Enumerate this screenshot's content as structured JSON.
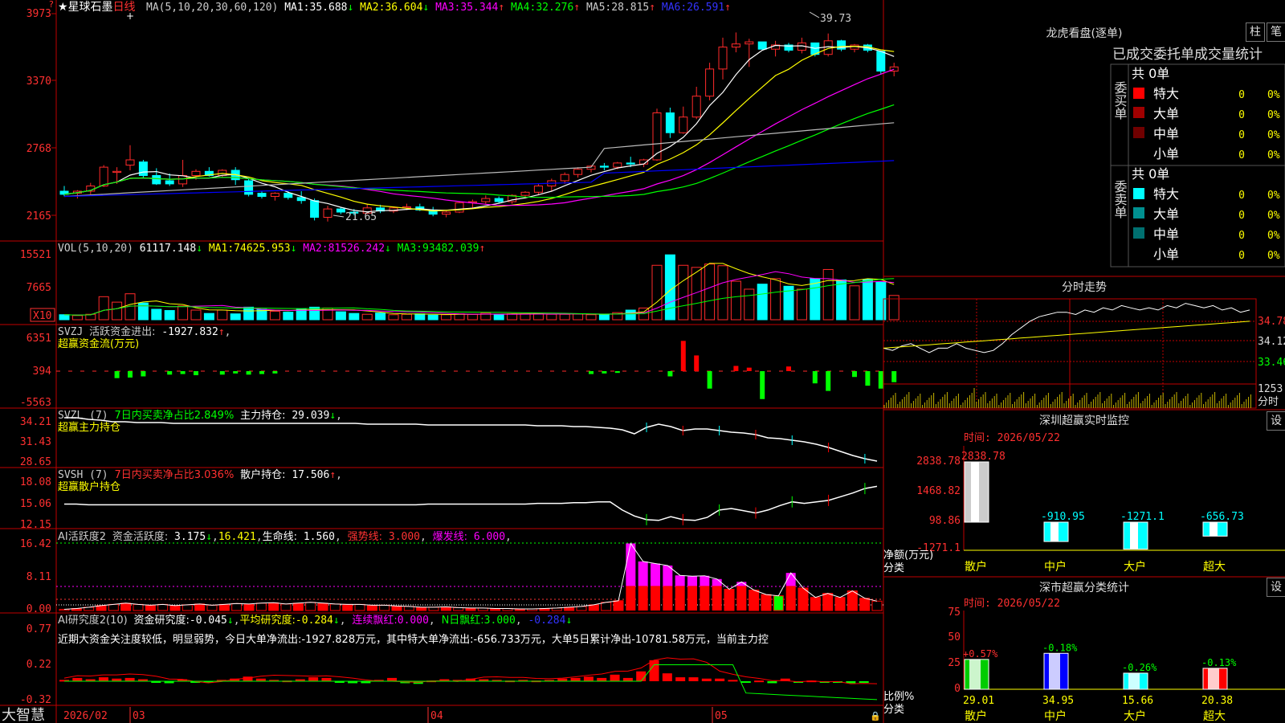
{
  "colors": {
    "up": "#ff2a2a",
    "down": "#00ffff",
    "ma1": "#ffffff",
    "ma2": "#ffff00",
    "ma3": "#ff00ff",
    "ma4": "#00ff00",
    "ma5": "#bbbbbb",
    "ma6": "#0000ff",
    "grid": "#c00000",
    "label": "#ff3030"
  },
  "main_panel": {
    "star": "★",
    "name": "星球石墨",
    "period": "日线",
    "ma_params": "MA(5,10,20,30,60,120)",
    "ma": [
      {
        "name": "MA1:",
        "value": "35.688",
        "arrow": "↓"
      },
      {
        "name": "MA2:",
        "value": "36.604",
        "arrow": "↓"
      },
      {
        "name": "MA3:",
        "value": "35.344",
        "arrow": "↑"
      },
      {
        "name": "MA4:",
        "value": "32.276",
        "arrow": "↑"
      },
      {
        "name": "MA5:",
        "value": "28.815",
        "arrow": "↑"
      },
      {
        "name": "MA6:",
        "value": "26.591",
        "arrow": "↑"
      }
    ],
    "yticks": [
      "3973",
      "3370",
      "2768",
      "2165"
    ],
    "high_label": "39.73",
    "low_label": "21.65"
  },
  "vol_panel": {
    "title": "VOL(5,10,20)",
    "value": "61117.148",
    "arrow": "↓",
    "ma": [
      {
        "name": "MA1:",
        "value": "74625.953",
        "arrow": "↓"
      },
      {
        "name": "MA2:",
        "value": "81526.242",
        "arrow": "↓"
      },
      {
        "name": "MA3:",
        "value": "93482.039",
        "arrow": "↑"
      }
    ],
    "yticks": [
      "15521",
      "7665"
    ],
    "unit": "X10"
  },
  "svzj_panel": {
    "code": "SVZJ",
    "label": "活跃资金进出:",
    "value": "-1927.832",
    "arrow": "↑",
    "tail": ",",
    "sub": "超赢资金流(万元)",
    "yticks": [
      "6351",
      "394",
      "-5563"
    ]
  },
  "svzl_panel": {
    "code": "SVZL (7)",
    "label": "7日内买卖净占比2.849%",
    "label2": "主力持仓:",
    "value": "29.039",
    "arrow": "↓",
    "tail": ",",
    "sub": "超赢主力持仓",
    "yticks": [
      "34.21",
      "31.43",
      "28.65"
    ]
  },
  "svsh_panel": {
    "code": "SVSH (7)",
    "label": "7日内买卖净占比3.036%",
    "label2": "散户持仓:",
    "value": "17.506",
    "arrow": "↑",
    "tail": ",",
    "sub": "超赢散户持仓",
    "yticks": [
      "18.08",
      "15.06",
      "12.15"
    ]
  },
  "ai1_panel": {
    "code": "AI活跃度2",
    "label": "资金活跃度:",
    "v1": "3.175",
    "a1": "↓",
    "v2": "16.421",
    "l3": "生命线:",
    "v3": "1.560",
    "l4": "强势线:",
    "v4": "3.000",
    "l5": "爆发线:",
    "v5": "6.000",
    "tail": ",",
    "yticks": [
      "16.42",
      "8.11",
      "0.00"
    ]
  },
  "ai2_panel": {
    "code": "AI研究度2(10)",
    "l1": "资金研究度:",
    "v1": "-0.045",
    "a1": "↓",
    "l2": "平均研究度:",
    "v2": "-0.284",
    "a2": "↓",
    "l3": "连续飘红:",
    "v3": "0.000",
    "l4": "N日飘红:",
    "v4": "3.000",
    "v5": "-0.284",
    "a5": "↓",
    "comment": "近期大资金关注度较低，明显弱势，今日大单净流出:-1927.828万元，其中特大单净流出:-656.733万元，大单5日累计净出-10781.58万元，当前主力控",
    "yticks": [
      "0.77",
      "0.22",
      "-0.32"
    ]
  },
  "bottom_bar": {
    "app": "大智慧",
    "start": "2026/02",
    "months": [
      "03",
      "04",
      "05"
    ]
  },
  "longhu": {
    "title": "龙虎看盘(逐单)",
    "btn1": "柱",
    "btn2": "笔",
    "tabs": "已成交委托单成交量统计",
    "buy": {
      "header": "共 0单",
      "side_label": "委买单",
      "rows": [
        {
          "name": "特大",
          "n": "0",
          "p": "0%"
        },
        {
          "name": "大单",
          "n": "0",
          "p": "0%"
        },
        {
          "name": "中单",
          "n": "0",
          "p": "0%"
        },
        {
          "name": "小单",
          "n": "0",
          "p": "0%"
        }
      ]
    },
    "sell": {
      "header": "共 0单",
      "side_label": "委卖单",
      "rows": [
        {
          "name": "特大",
          "n": "0",
          "p": "0%"
        },
        {
          "name": "大单",
          "n": "0",
          "p": "0%"
        },
        {
          "name": "中单",
          "n": "0",
          "p": "0%"
        },
        {
          "name": "小单",
          "n": "0",
          "p": "0%"
        }
      ]
    }
  },
  "intraday": {
    "title": "分时走势",
    "right": [
      "34.78",
      "34.12",
      "33.46",
      "1253"
    ],
    "foot": "分时"
  },
  "monitor": {
    "title": "深圳超赢实时监控",
    "btn": "设",
    "time": "时间: 2026/05/22",
    "yticks": [
      "2838.78",
      "1468.82",
      "98.86",
      "-1271.1"
    ],
    "bar_labels": [
      "2838.78",
      "-910.95",
      "-1271.1",
      "-656.73"
    ],
    "cats": [
      "散户",
      "中户",
      "大户",
      "超大"
    ],
    "ylabel": "净额(万元)",
    "xlabel": "分类"
  },
  "classify": {
    "title": "深市超赢分类统计",
    "btn": "设",
    "time": "时间: 2026/05/22",
    "yticks": [
      "75",
      "50",
      "25",
      "0"
    ],
    "top_labels": [
      "+0.57%",
      "-0.18%",
      "-0.26%",
      "-0.13%"
    ],
    "bottom_labels": [
      "29.01",
      "34.95",
      "15.66",
      "20.38"
    ],
    "cats": [
      "散户",
      "中户",
      "大户",
      "超大"
    ],
    "ylabel": "比例%",
    "xlabel": "分类"
  },
  "chart_data": [
    {
      "type": "candlestick",
      "name": "星球石墨 日线",
      "ylim": [
        20.5,
        41.5
      ],
      "ohlc": [
        [
          24.5,
          25.0,
          24.0,
          24.2
        ],
        [
          24.3,
          24.6,
          23.8,
          24.5
        ],
        [
          24.5,
          25.3,
          24.2,
          25.0
        ],
        [
          25.0,
          27.0,
          24.9,
          26.8
        ],
        [
          26.3,
          26.8,
          25.2,
          26.4
        ],
        [
          27.0,
          28.9,
          26.5,
          27.5
        ],
        [
          27.3,
          27.5,
          25.8,
          26.0
        ],
        [
          26.0,
          26.7,
          25.1,
          25.2
        ],
        [
          25.5,
          26.2,
          25.0,
          25.2
        ],
        [
          25.2,
          27.5,
          24.9,
          26.0
        ],
        [
          26.0,
          26.6,
          25.6,
          26.4
        ],
        [
          26.4,
          26.8,
          25.9,
          26.0
        ],
        [
          26.0,
          26.6,
          25.8,
          26.5
        ],
        [
          26.5,
          26.8,
          25.1,
          25.6
        ],
        [
          25.5,
          25.7,
          24.0,
          24.2
        ],
        [
          24.3,
          24.5,
          23.8,
          24.0
        ],
        [
          24.0,
          24.4,
          23.6,
          24.3
        ],
        [
          24.3,
          24.5,
          23.7,
          23.9
        ],
        [
          23.9,
          24.5,
          23.3,
          23.6
        ],
        [
          23.6,
          23.8,
          21.7,
          22.0
        ],
        [
          22.0,
          23.1,
          21.6,
          22.8
        ],
        [
          22.8,
          23.0,
          22.3,
          22.5
        ],
        [
          22.5,
          22.8,
          22.2,
          22.4
        ],
        [
          22.4,
          23.3,
          22.3,
          22.9
        ],
        [
          22.9,
          23.2,
          22.4,
          22.6
        ],
        [
          22.6,
          23.0,
          22.4,
          22.9
        ],
        [
          22.9,
          23.3,
          22.7,
          23.0
        ],
        [
          23.0,
          23.3,
          22.6,
          22.7
        ],
        [
          22.7,
          23.0,
          22.1,
          22.3
        ],
        [
          22.3,
          22.6,
          22.0,
          22.5
        ],
        [
          22.5,
          23.5,
          22.4,
          23.4
        ],
        [
          23.4,
          23.7,
          22.9,
          23.5
        ],
        [
          23.5,
          24.1,
          23.3,
          23.8
        ],
        [
          23.8,
          24.0,
          23.3,
          23.5
        ],
        [
          23.5,
          24.2,
          23.3,
          24.1
        ],
        [
          24.1,
          24.5,
          23.8,
          24.4
        ],
        [
          24.4,
          25.2,
          24.1,
          25.0
        ],
        [
          25.0,
          25.7,
          24.5,
          25.5
        ],
        [
          25.5,
          26.3,
          25.2,
          26.1
        ],
        [
          26.1,
          26.8,
          25.8,
          26.6
        ],
        [
          26.6,
          27.0,
          26.3,
          26.9
        ],
        [
          26.9,
          27.2,
          26.5,
          26.8
        ],
        [
          26.8,
          27.3,
          26.6,
          27.2
        ],
        [
          27.2,
          27.8,
          26.8,
          27.1
        ],
        [
          27.1,
          27.6,
          26.8,
          27.5
        ],
        [
          27.5,
          32.4,
          27.4,
          32.0
        ],
        [
          32.0,
          32.5,
          29.6,
          30.1
        ],
        [
          30.1,
          32.6,
          30.0,
          31.6
        ],
        [
          31.6,
          34.5,
          31.4,
          33.6
        ],
        [
          33.6,
          36.8,
          33.2,
          36.2
        ],
        [
          36.2,
          39.2,
          35.2,
          38.3
        ],
        [
          38.3,
          39.7,
          37.8,
          38.6
        ],
        [
          38.6,
          39.1,
          36.4,
          38.8
        ],
        [
          38.8,
          38.8,
          38.0,
          38.1
        ],
        [
          38.1,
          38.9,
          37.4,
          38.5
        ],
        [
          38.5,
          38.7,
          37.8,
          38.0
        ],
        [
          38.0,
          39.2,
          37.7,
          38.7
        ],
        [
          38.7,
          38.7,
          37.4,
          37.6
        ],
        [
          37.6,
          39.6,
          37.4,
          38.9
        ],
        [
          38.9,
          39.0,
          37.9,
          38.1
        ],
        [
          38.1,
          38.6,
          37.8,
          38.5
        ],
        [
          38.5,
          38.6,
          37.8,
          38.0
        ],
        [
          37.9,
          37.9,
          35.7,
          36.0
        ],
        [
          36.0,
          36.8,
          35.5,
          36.4
        ]
      ]
    },
    {
      "type": "bar",
      "name": "VOL",
      "ylim": [
        0,
        16500
      ],
      "values": [
        1200,
        1000,
        1300,
        5500,
        4200,
        6200,
        4000,
        2500,
        2200,
        3300,
        2300,
        1500,
        2300,
        1400,
        3000,
        2500,
        2000,
        1800,
        2500,
        3000,
        2800,
        1900,
        1500,
        1300,
        1600,
        1200,
        1300,
        1400,
        1100,
        1200,
        1400,
        1300,
        1600,
        1200,
        1400,
        1400,
        1500,
        1300,
        1300,
        1400,
        1200,
        1300,
        1700,
        2300,
        2800,
        13000,
        15500,
        13000,
        12500,
        13300,
        12900,
        9200,
        7300,
        8500,
        9800,
        8000,
        7300,
        9800,
        12000,
        9500,
        8100,
        9600,
        9000,
        5800
      ]
    },
    {
      "type": "bar",
      "name": "超赢资金流(万元)",
      "ylim": [
        -6000,
        6600
      ],
      "values": [
        0,
        0,
        0,
        0,
        -1200,
        -1100,
        -900,
        0,
        -600,
        -500,
        -700,
        0,
        -600,
        -400,
        -600,
        -500,
        -400,
        0,
        0,
        0,
        0,
        0,
        0,
        0,
        0,
        0,
        0,
        0,
        0,
        0,
        0,
        0,
        0,
        0,
        0,
        0,
        0,
        0,
        0,
        0,
        -500,
        -400,
        -300,
        0,
        0,
        0,
        -900,
        5200,
        2700,
        -3000,
        0,
        900,
        600,
        -4800,
        0,
        800,
        0,
        -2100,
        -3400,
        0,
        -1000,
        -2500,
        -3000,
        -1900
      ]
    },
    {
      "type": "line",
      "name": "超赢主力持仓",
      "ylim": [
        28.2,
        34.6
      ],
      "values": [
        34.1,
        34.1,
        33.9,
        33.8,
        33.6,
        33.6,
        33.5,
        33.5,
        33.5,
        33.4,
        33.4,
        33.4,
        33.4,
        33.4,
        33.4,
        33.4,
        33.4,
        33.4,
        33.4,
        33.4,
        33.4,
        33.4,
        33.4,
        33.4,
        33.4,
        33.3,
        33.3,
        33.3,
        33.3,
        33.3,
        33.2,
        33.2,
        33.2,
        33.2,
        33.2,
        33.2,
        33.2,
        33.2,
        33.2,
        33.1,
        33.1,
        33.1,
        33.0,
        33.0,
        32.9,
        32.8,
        32.6,
        32.1,
        32.9,
        33.3,
        33.0,
        32.5,
        32.7,
        32.7,
        32.5,
        32.3,
        32.2,
        32.0,
        31.6,
        31.5,
        31.3,
        31.1,
        30.8,
        30.4,
        29.9,
        29.4,
        29.0,
        28.7
      ]
    },
    {
      "type": "line",
      "name": "超赢散户持仓",
      "ylim": [
        11.9,
        18.3
      ],
      "values": [
        15.1,
        15.1,
        15.0,
        15.0,
        15.0,
        15.0,
        15.0,
        15.0,
        15.0,
        15.0,
        15.0,
        15.0,
        15.0,
        15.0,
        15.0,
        15.0,
        15.0,
        15.0,
        15.0,
        15.0,
        15.0,
        15.0,
        15.0,
        15.0,
        15.0,
        15.0,
        15.0,
        15.0,
        15.0,
        15.0,
        15.1,
        15.1,
        15.1,
        15.1,
        15.1,
        15.1,
        15.1,
        15.1,
        15.1,
        15.2,
        15.2,
        15.2,
        15.3,
        15.3,
        15.4,
        15.4,
        14.3,
        13.5,
        13.0,
        12.9,
        13.4,
        13.0,
        12.9,
        13.3,
        14.3,
        14.5,
        14.2,
        13.9,
        14.3,
        14.9,
        15.4,
        15.2,
        15.4,
        15.6,
        16.1,
        16.6,
        17.2,
        17.5
      ]
    },
    {
      "type": "bar",
      "name": "资金活跃度",
      "ylim": [
        0,
        16.5
      ],
      "values": [
        0.3,
        0.5,
        0.8,
        1.2,
        1.5,
        1.8,
        1.5,
        1.3,
        1.5,
        1.2,
        1.4,
        1.6,
        1.3,
        1.5,
        1.7,
        1.6,
        1.8,
        1.9,
        1.6,
        1.8,
        2.0,
        1.8,
        1.6,
        1.5,
        1.5,
        1.3,
        1.3,
        1.1,
        1.0,
        0.8,
        0.8,
        0.9,
        0.7,
        0.6,
        0.6,
        0.5,
        0.5,
        0.4,
        0.4,
        0.5,
        0.6,
        0.8,
        1.0,
        1.4,
        2.0,
        2.4,
        16.4,
        12.0,
        11.5,
        11.0,
        8.6,
        8.4,
        8.5,
        7.7,
        5.2,
        7.0,
        5.0,
        3.9,
        3.6,
        9.2,
        5.5,
        3.2,
        4.2,
        3.2,
        4.8,
        3.0,
        2.3
      ]
    },
    {
      "type": "bar",
      "name": "资金研究度",
      "ylim": [
        -0.34,
        0.8
      ],
      "values": [
        0.02,
        0.05,
        0.03,
        0.06,
        0.04,
        0.05,
        0.03,
        -0.02,
        -0.03,
        0.03,
        -0.02,
        -0.01,
        0.02,
        0.04,
        0.07,
        0.04,
        0.02,
        0.01,
        0.03,
        0.06,
        0.05,
        -0.01,
        -0.03,
        -0.03,
        0.02,
        0.05,
        -0.03,
        -0.04,
        0.01,
        0.03,
        0.02,
        0.04,
        0.03,
        0.02,
        0.01,
        0.02,
        0.01,
        0.02,
        0.04,
        0.05,
        0.07,
        0.05,
        0.1,
        0.05,
        0.15,
        0.32,
        0.12,
        0.06,
        0.06,
        0.04,
        0.04,
        0.02,
        -0.02,
        0.01,
        -0.03,
        0.04,
        -0.02,
        0.01,
        -0.02,
        -0.02,
        -0.03,
        -0.01,
        0.0
      ]
    },
    {
      "type": "line",
      "name": "分时走势",
      "ylim": [
        33.2,
        35.1
      ],
      "values": [
        34.0,
        33.95,
        34.05,
        34.1,
        34.0,
        33.9,
        34.0,
        34.0,
        34.1,
        34.0,
        33.95,
        33.9,
        33.95,
        34.1,
        34.3,
        34.45,
        34.6,
        34.7,
        34.75,
        34.8,
        34.8,
        34.75,
        34.85,
        34.8,
        34.9,
        34.85,
        34.95,
        34.9,
        34.85,
        34.9,
        34.85,
        34.95,
        34.9,
        35.0,
        34.95,
        34.9,
        34.95,
        34.85,
        34.9,
        34.8,
        34.85
      ]
    },
    {
      "type": "bar",
      "name": "深圳超赢实时监控",
      "categories": [
        "散户",
        "中户",
        "大户",
        "超大"
      ],
      "values": [
        2838.78,
        -910.95,
        -1271.1,
        -656.73
      ],
      "ylim": [
        -1271.1,
        2838.78
      ]
    },
    {
      "type": "bar",
      "name": "深市超赢分类统计",
      "categories": [
        "散户",
        "中户",
        "大户",
        "超大"
      ],
      "values": [
        29.01,
        34.95,
        15.66,
        20.38
      ],
      "changes": [
        "+0.57%",
        "-0.18%",
        "-0.26%",
        "-0.13%"
      ],
      "ylim": [
        0,
        75
      ]
    }
  ]
}
